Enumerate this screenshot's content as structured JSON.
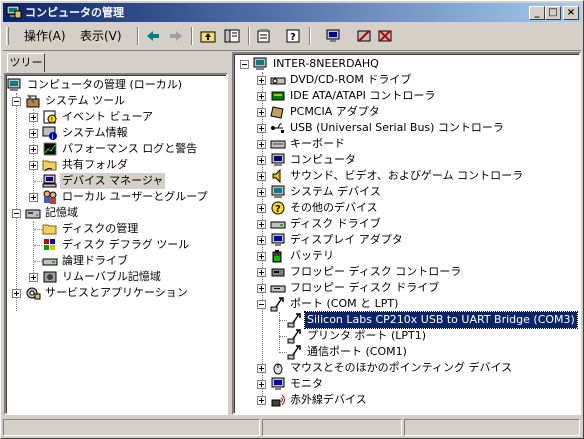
{
  "window": {
    "title": "コンピュータの管理",
    "controls": {
      "minimize": "_",
      "maximize": "□",
      "close": "×"
    }
  },
  "menu": {
    "action": "操作(A)",
    "view": "表示(V)"
  },
  "toolbar": {
    "buttons": [
      "back-arrow-icon",
      "forward-arrow-icon",
      "up-folder-icon",
      "show-hide-tree-icon",
      "properties-icon",
      "help-icon",
      "scan-hardware-icon",
      "uninstall-icon",
      "disable-icon"
    ]
  },
  "left": {
    "tab": "ツリー",
    "root": "コンピュータの管理 (ローカル)",
    "system_tools": "システム ツール",
    "event_viewer": "イベント ビューア",
    "system_info": "システム情報",
    "perf_logs": "パフォーマンス ログと警告",
    "shared_folders": "共有フォルダ",
    "device_manager": "デバイス マネージャ",
    "local_users": "ローカル ユーザーとグループ",
    "storage": "記憶域",
    "disk_mgmt": "ディスクの管理",
    "defrag": "ディスク デフラグ ツール",
    "logical_drives": "論理ドライブ",
    "removable": "リムーバブル記憶域",
    "services": "サービスとアプリケーション"
  },
  "right": {
    "computer": "INTER-8NEERDAHQ",
    "items": [
      "DVD/CD-ROM ドライブ",
      "IDE ATA/ATAPI コントローラ",
      "PCMCIA アダプタ",
      "USB (Universal Serial Bus) コントローラ",
      "キーボード",
      "コンピュータ",
      "サウンド、ビデオ、およびゲーム コントローラ",
      "システム デバイス",
      "その他のデバイス",
      "ディスク ドライブ",
      "ディスプレイ アダプタ",
      "バッテリ",
      "フロッピー ディスク コントローラ",
      "フロッピー ディスク ドライブ",
      "ポート (COM と LPT)"
    ],
    "ports": [
      "Silicon Labs CP210x USB to UART Bridge (COM3)",
      "プリンタ ポート (LPT1)",
      "通信ポート (COM1)"
    ],
    "after": [
      "マウスとそのほかのポインティング デバイス",
      "モニタ",
      "赤外線デバイス"
    ]
  },
  "colors": {
    "title_start": "#0a246a",
    "title_end": "#a6caf0",
    "selection": "#0a246a",
    "face": "#d4d0c8"
  }
}
